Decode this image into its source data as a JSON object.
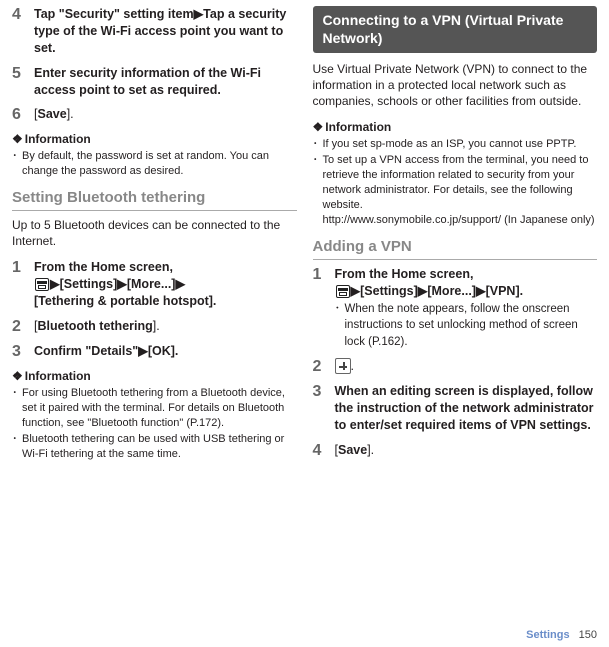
{
  "left": {
    "step4": "Tap \"Security\" setting item▶Tap a security type of the Wi-Fi access point you want to set.",
    "step5": "Enter security information of the Wi-Fi access point to set as required.",
    "step6_prefix": "[",
    "step6_label": "Save",
    "step6_suffix": "].",
    "info_head": "Information",
    "info1": "By default, the password is set at random. You can change the password as desired.",
    "bt_heading": "Setting Bluetooth tethering",
    "bt_desc": "Up to 5 Bluetooth devices can be connected to the Internet.",
    "bt_step1_line1": "From the Home screen,",
    "bt_step1_line2a": "▶[Settings]▶[More...]▶",
    "bt_step1_line3": "[Tethering & portable hotspot].",
    "bt_step2_prefix": "[",
    "bt_step2_label": "Bluetooth tethering",
    "bt_step2_suffix": "].",
    "bt_step3": "Confirm \"Details\"▶[OK].",
    "bt_info_head": "Information",
    "bt_info1": "For using Bluetooth tethering from a Bluetooth device, set it paired with the terminal. For details on Bluetooth function, see \"Bluetooth function\" (P.172).",
    "bt_info2": "Bluetooth tethering can be used with USB tethering or Wi-Fi tethering at the same time."
  },
  "right": {
    "section_title": "Connecting to a VPN (Virtual Private Network)",
    "section_desc": "Use Virtual Private Network (VPN) to connect to the information in a protected local network such as companies, schools or other facilities from outside.",
    "info_head": "Information",
    "info1": "If you set sp-mode as an ISP, you cannot use PPTP.",
    "info2": "To set up a VPN access from the terminal, you need to retrieve the information related to security from your network administrator. For details, see the following website.",
    "info2_url": "http://www.sonymobile.co.jp/support/ (In Japanese only)",
    "add_heading": "Adding a VPN",
    "vpn_step1_line1": "From the Home screen,",
    "vpn_step1_line2": "▶[Settings]▶[More...]▶[VPN].",
    "vpn_step1_note": "When the note appears, follow the onscreen instructions to set unlocking method of screen lock (P.162).",
    "vpn_step2_suffix": ".",
    "vpn_step3": "When an editing screen is displayed, follow the instruction of the network administrator to enter/set required items of VPN settings.",
    "vpn_step4_prefix": "[",
    "vpn_step4_label": "Save",
    "vpn_step4_suffix": "]."
  },
  "footer": {
    "section": "Settings",
    "page": "150"
  },
  "nums": {
    "n1": "1",
    "n2": "2",
    "n3": "3",
    "n4": "4",
    "n5": "5",
    "n6": "6"
  }
}
